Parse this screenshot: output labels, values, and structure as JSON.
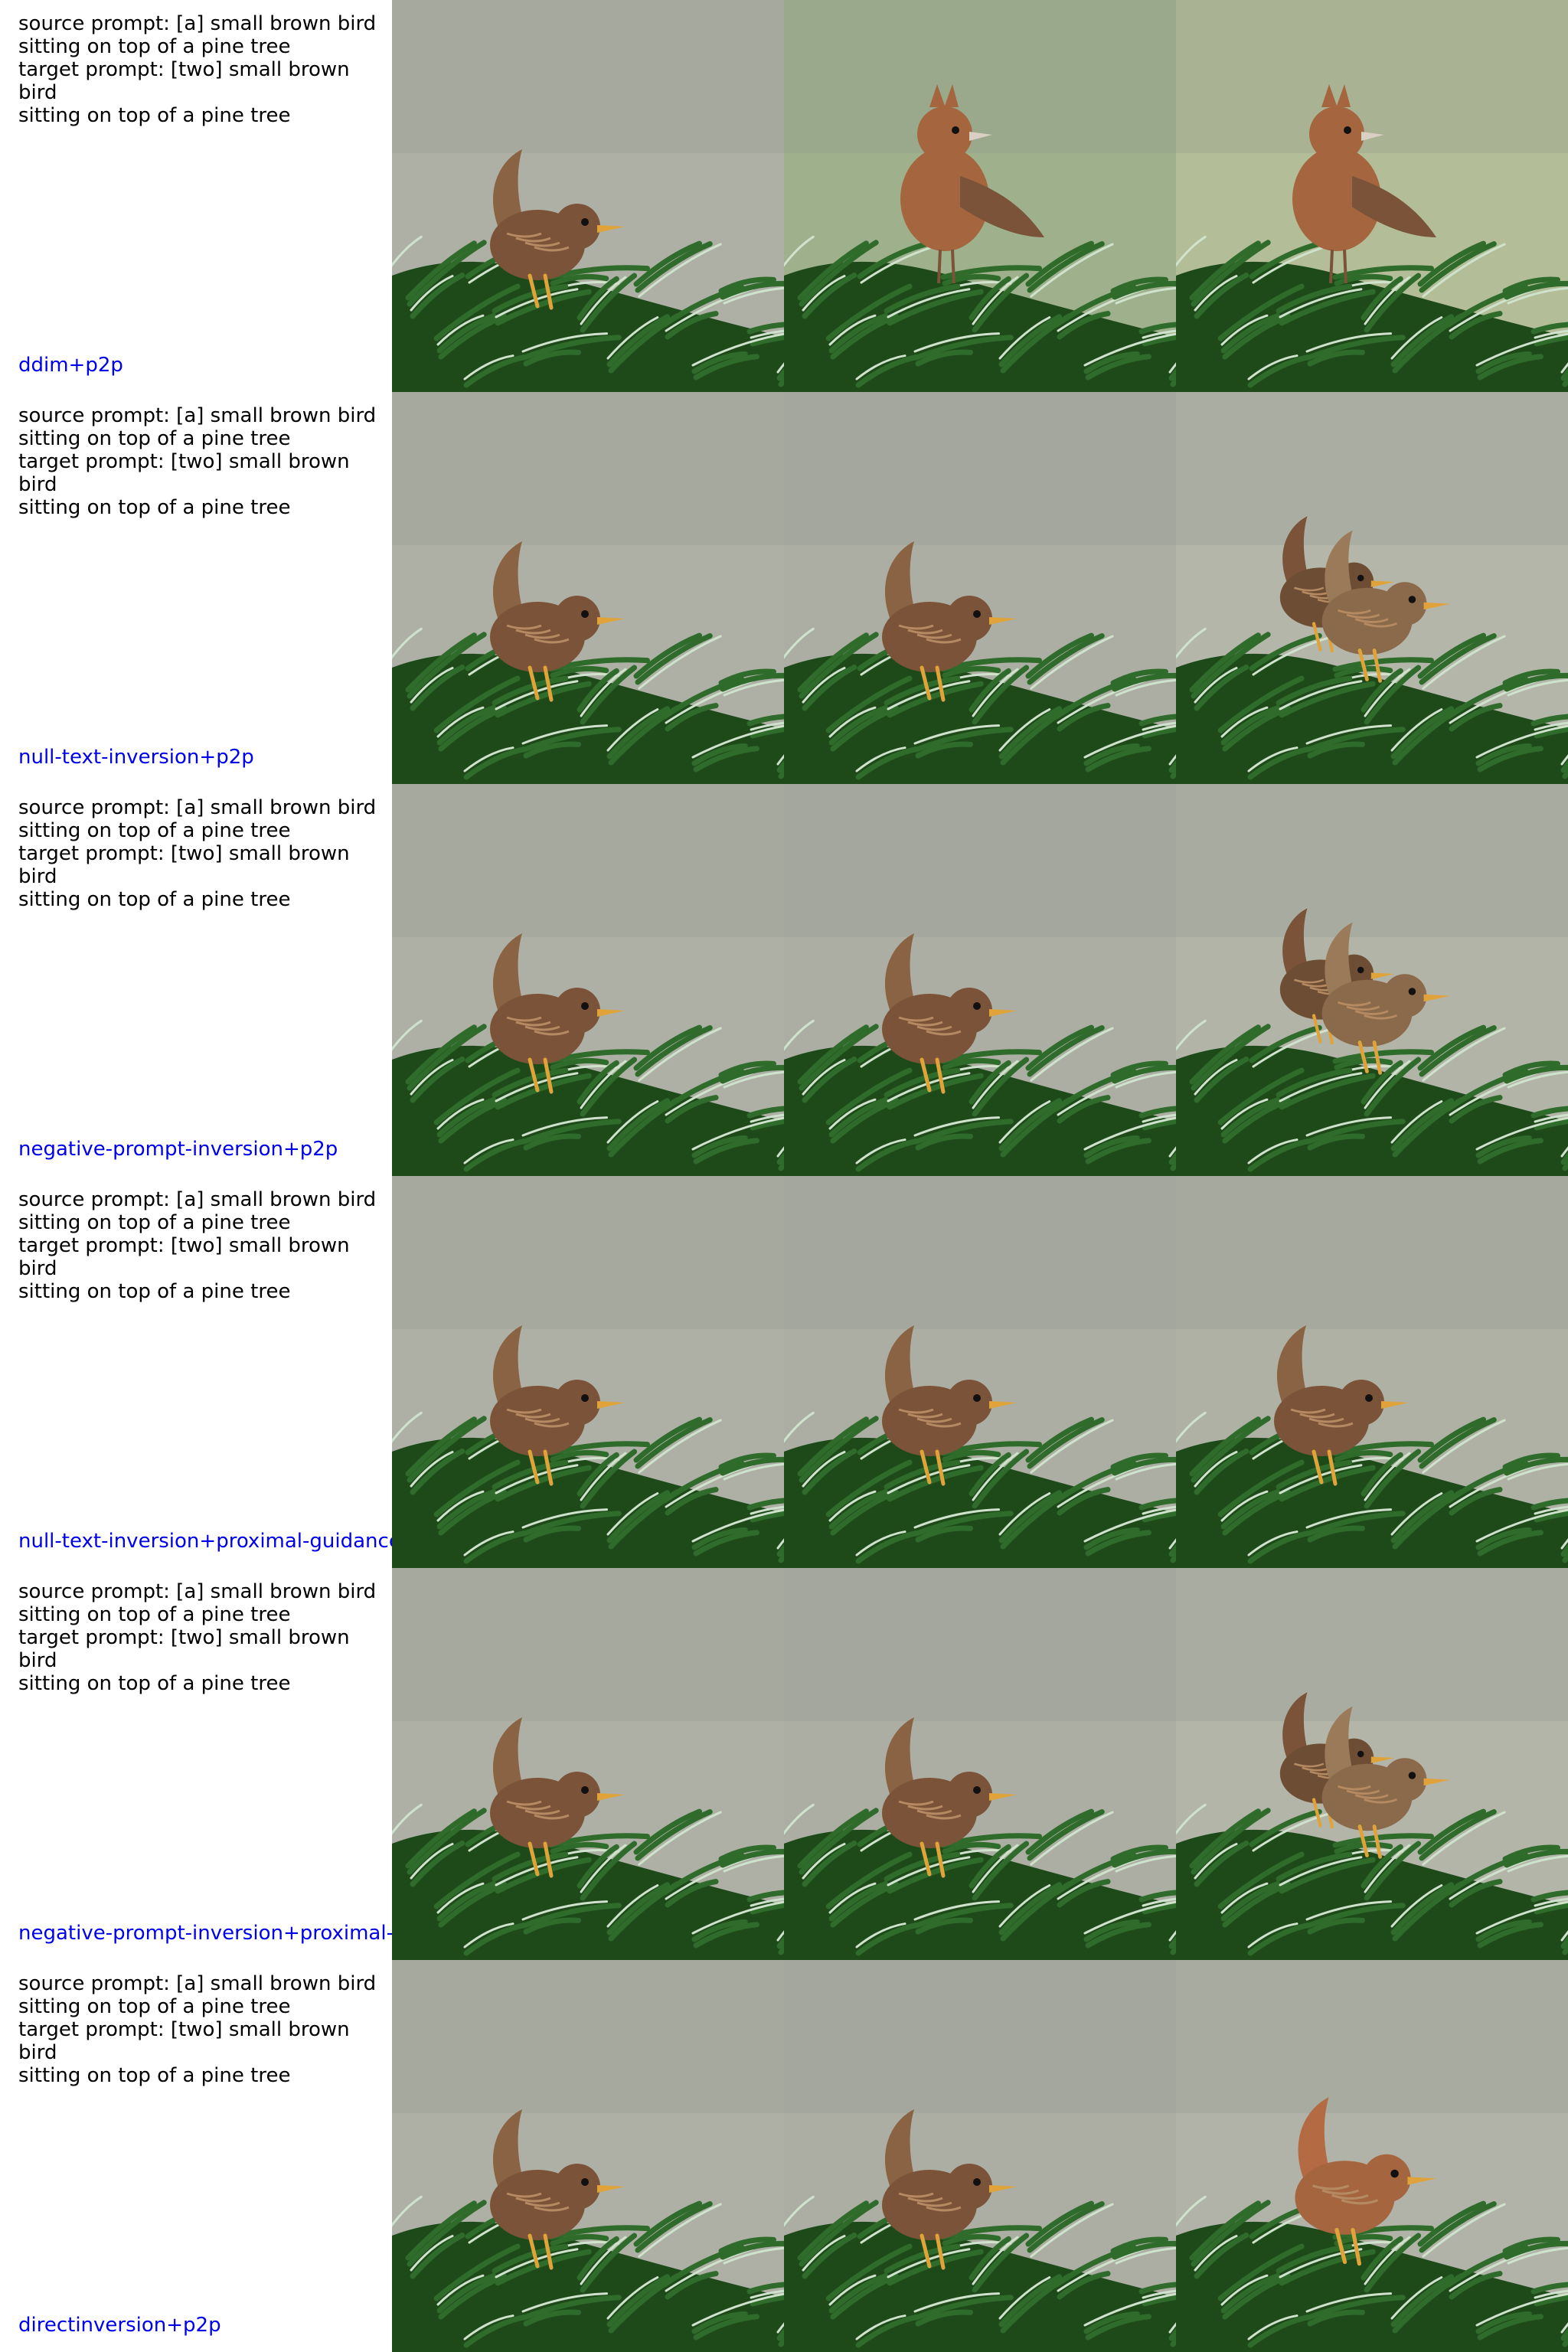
{
  "palette": {
    "method_label_color": "#0000ee",
    "text_color": "#000000",
    "bird_brown": "#7a5338",
    "bird_light": "#b58a63",
    "bird_rufous": "#a5653f",
    "beak": "#e0a339",
    "pine_dark": "#1e4a1a",
    "pine_mid": "#2f6b2a",
    "pine_light": "#cfe2cc"
  },
  "rows": [
    {
      "source_line1": "source prompt: [a] small brown bird",
      "source_line2": "sitting on top of a pine tree",
      "target_line1": "target prompt: [two] small brown bird",
      "target_line2": "sitting on top of a pine tree",
      "method": "ddim+p2p",
      "images": [
        {
          "icon": "wren-on-pine-source",
          "background": "#aeb0a6"
        },
        {
          "icon": "crested-bird-on-pine-reconstruction",
          "background": "#9fb08c"
        },
        {
          "icon": "crested-bird-on-pine-edit",
          "background": "#b3be98"
        }
      ]
    },
    {
      "source_line1": "source prompt: [a] small brown bird",
      "source_line2": "sitting on top of a pine tree",
      "target_line1": "target prompt: [two] small brown bird",
      "target_line2": "sitting on top of a pine tree",
      "method": "null-text-inversion+p2p",
      "images": [
        {
          "icon": "wren-on-pine-source",
          "background": "#aeb0a6"
        },
        {
          "icon": "wren-on-pine-reconstruction",
          "background": "#acaea4"
        },
        {
          "icon": "two-birds-on-pine-edit",
          "background": "#b4b6aa"
        }
      ]
    },
    {
      "source_line1": "source prompt: [a] small brown bird",
      "source_line2": "sitting on top of a pine tree",
      "target_line1": "target prompt: [two] small brown bird",
      "target_line2": "sitting on top of a pine tree",
      "method": "negative-prompt-inversion+p2p",
      "images": [
        {
          "icon": "wren-on-pine-source",
          "background": "#aeb0a6"
        },
        {
          "icon": "wren-on-pine-reconstruction",
          "background": "#acaea4"
        },
        {
          "icon": "two-birds-on-pine-edit",
          "background": "#b2b4a8"
        }
      ]
    },
    {
      "source_line1": "source prompt: [a] small brown bird",
      "source_line2": "sitting on top of a pine tree",
      "target_line1": "target prompt: [two] small brown bird",
      "target_line2": "sitting on top of a pine tree",
      "method": "null-text-inversion+proximal-guidance",
      "images": [
        {
          "icon": "wren-on-pine-source",
          "background": "#aeb0a6"
        },
        {
          "icon": "wren-on-pine-reconstruction",
          "background": "#acaea4"
        },
        {
          "icon": "wren-on-pine-edit",
          "background": "#afb1a5"
        }
      ]
    },
    {
      "source_line1": "source prompt: [a] small brown bird",
      "source_line2": "sitting on top of a pine tree",
      "target_line1": "target prompt: [two] small brown bird",
      "target_line2": "sitting on top of a pine tree",
      "method": "negative-prompt-inversion+proximal-g",
      "images": [
        {
          "icon": "wren-on-pine-source",
          "background": "#aeb0a6"
        },
        {
          "icon": "wren-on-pine-reconstruction",
          "background": "#acaea4"
        },
        {
          "icon": "two-birds-on-pine-edit",
          "background": "#b3b5a9"
        }
      ]
    },
    {
      "source_line1": "source prompt: [a] small brown bird",
      "source_line2": "sitting on top of a pine tree",
      "target_line1": "target prompt: [two] small brown bird",
      "target_line2": "sitting on top of a pine tree",
      "method": "directinversion+p2p",
      "images": [
        {
          "icon": "wren-on-pine-source",
          "background": "#aeb0a6"
        },
        {
          "icon": "wren-on-pine-reconstruction",
          "background": "#acaea4"
        },
        {
          "icon": "rufous-wren-on-pine-edit",
          "background": "#b1b3a8"
        }
      ]
    }
  ]
}
